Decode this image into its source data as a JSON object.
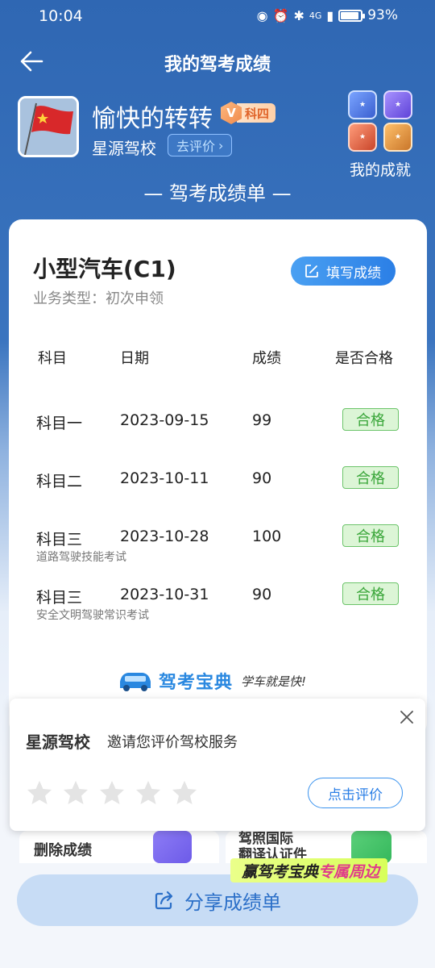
{
  "status_bar": {
    "time": "10:04",
    "network": "4G",
    "battery": "93%",
    "battery_level": 0.93
  },
  "header": {
    "title": "我的驾考成绩"
  },
  "profile": {
    "username": "愉快的转转",
    "level_letter": "V",
    "level": "科四",
    "school": "星源驾校",
    "rate_school_label": "去评价",
    "achievements_label": "我的成就"
  },
  "section_heading": "— 驾考成绩单 —",
  "card": {
    "license_title": "小型汽车(C1)",
    "business_type": "业务类型：初次申领",
    "fill_score_label": "填写成绩",
    "columns": {
      "subject": "科目",
      "date": "日期",
      "score": "成绩",
      "passed": "是否合格"
    },
    "rows": [
      {
        "subject": "科目一",
        "date": "2023-09-15",
        "score": "99",
        "result": "合格",
        "note": ""
      },
      {
        "subject": "科目二",
        "date": "2023-10-11",
        "score": "90",
        "result": "合格",
        "note": ""
      },
      {
        "subject": "科目三",
        "date": "2023-10-28",
        "score": "100",
        "result": "合格",
        "note": "道路驾驶技能考试"
      },
      {
        "subject": "科目三",
        "date": "2023-10-31",
        "score": "90",
        "result": "合格",
        "note": "安全文明驾驶常识考试"
      }
    ],
    "brand_name": "驾考宝典",
    "brand_slogan": "学车就是快!"
  },
  "rate_popup": {
    "school": "星源驾校",
    "text": "邀请您评价驾校服务",
    "stars_total": 5,
    "stars_selected": 0,
    "button_label": "点击评价"
  },
  "bottom": {
    "delete_label": "删除成绩",
    "intl_label_line1": "驾照国际",
    "intl_label_line2": "翻译认证件",
    "promo_prefix": "赢驾考宝典",
    "promo_highlight": "专属周边",
    "share_label": "分享成绩单"
  },
  "colors": {
    "primary": "#2f67b3",
    "accent": "#2b7fe6",
    "pass_green": "#3aa63a",
    "level_orange": "#f08a4b"
  }
}
